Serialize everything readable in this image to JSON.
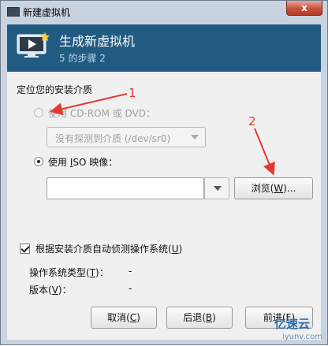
{
  "window": {
    "title": "新建虚拟机",
    "close": "x"
  },
  "banner": {
    "title": "生成新虚拟机",
    "step": "5 的步骤 2"
  },
  "section": {
    "title": "定位您的安装介质"
  },
  "cdrom": {
    "label": "使用  CD-ROM 或  DVD：",
    "selected": false,
    "enabled": false,
    "combo_value": "没有探测到介质 (/dev/sr0)"
  },
  "iso": {
    "label_pre": "使用  ",
    "label_key": "I",
    "label_post": "SO 映像：",
    "selected": true,
    "path_value": "",
    "browse_pre": "浏览(",
    "browse_key": "W",
    "browse_post": ")..."
  },
  "autodetect": {
    "checked": true,
    "label_pre": "根据安装介质自动侦测操作系统(",
    "label_key": "U",
    "label_post": ")"
  },
  "os_type": {
    "label_pre": "操作系统类型(",
    "label_key": "T",
    "label_post": ")：",
    "value": "-"
  },
  "os_version": {
    "label_pre": "版本(",
    "label_key": "V",
    "label_post": ")：",
    "value": "-"
  },
  "buttons": {
    "cancel": {
      "pre": "取消(",
      "key": "C",
      "post": ")"
    },
    "back": {
      "pre": "后退(",
      "key": "B",
      "post": ")"
    },
    "forward": {
      "pre": "前进(",
      "key": "F",
      "post": ")"
    }
  },
  "annotations": [
    "1",
    "2"
  ],
  "watermark": {
    "text": "亿速云",
    "url_text": "iyunv.com"
  },
  "colors": {
    "banner": "#225b82",
    "annotation": "#e23b2e"
  }
}
